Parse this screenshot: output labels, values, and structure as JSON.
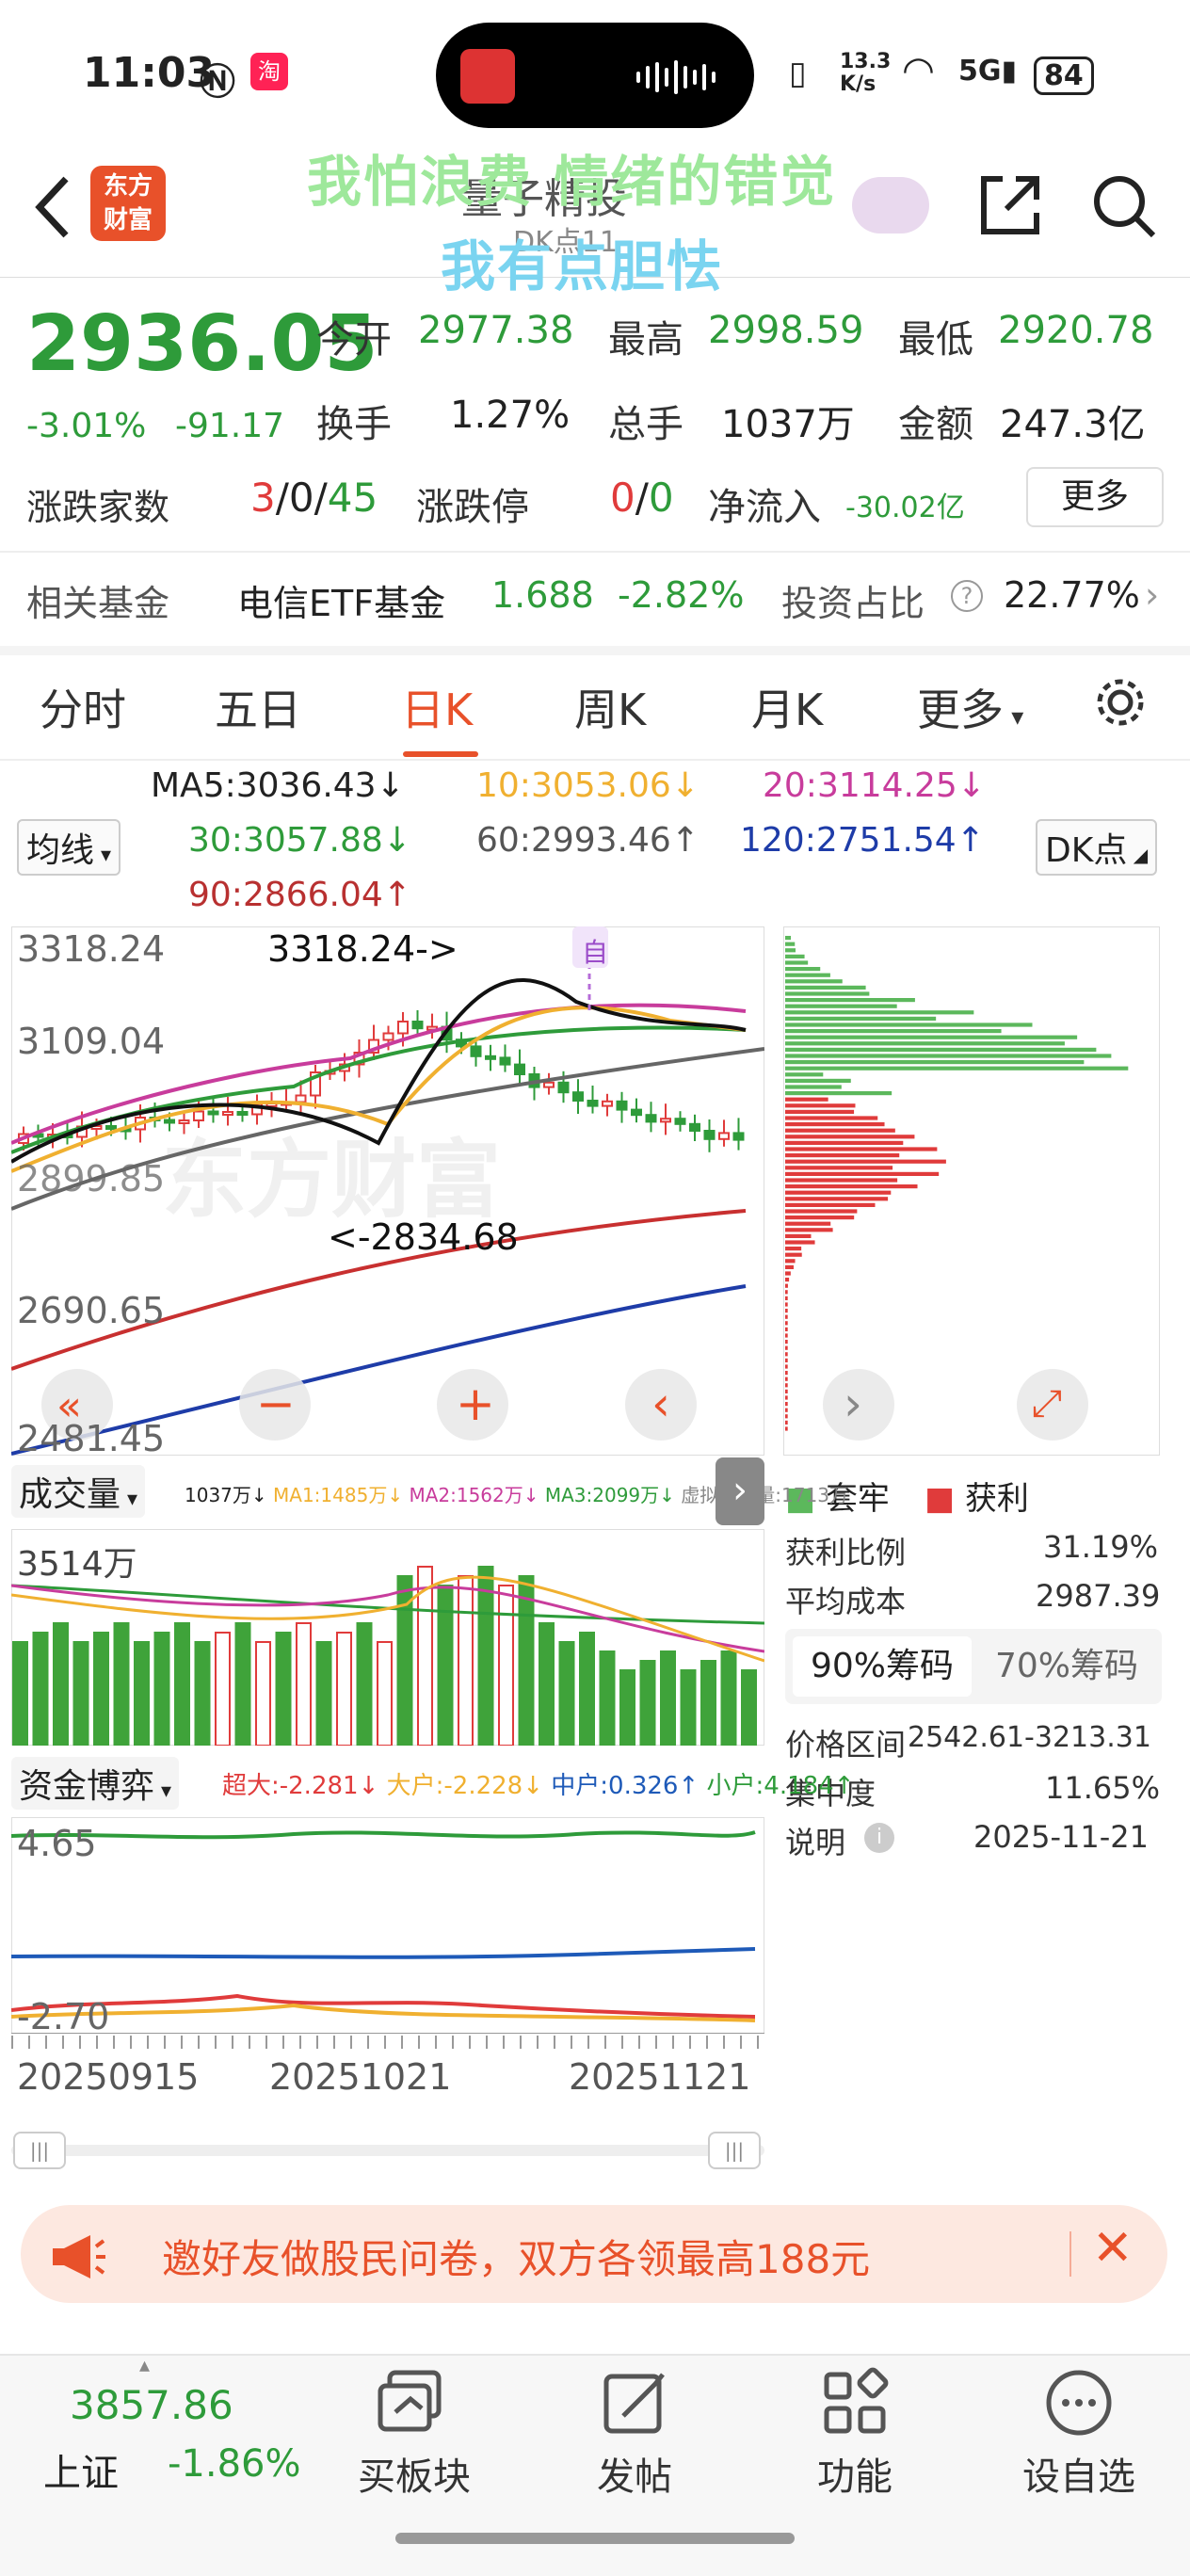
{
  "status": {
    "time": "11:03",
    "net_speed": "13.3\nK/s",
    "battery": "84",
    "signal": "5G"
  },
  "overlay": {
    "line1": "我怕浪费 情绪的错觉",
    "line2": "我有点胆怯"
  },
  "header": {
    "title": "量子精投",
    "subtitle": "DK点11",
    "logo_text": "东方\n财富"
  },
  "quote": {
    "price": "2936.05",
    "pct": "-3.01%",
    "change": "-91.17",
    "open_label": "今开",
    "open": "2977.38",
    "high_label": "最高",
    "high": "2998.59",
    "low_label": "最低",
    "low": "2920.78",
    "turnover_label": "换手",
    "turnover": "1.27%",
    "volume_label": "总手",
    "volume": "1037万",
    "amount_label": "金额",
    "amount": "247.3亿",
    "updown_label": "涨跌家数",
    "up": "3",
    "flat": "0",
    "down": "45",
    "limit_label": "涨跌停",
    "limit_up": "0",
    "limit_down": "0",
    "inflow_label": "净流入",
    "inflow": "-30.02亿",
    "more_button": "更多"
  },
  "fund": {
    "label": "相关基金",
    "name": "电信ETF基金",
    "price": "1.688",
    "pct": "-2.82%",
    "ratio_label": "投资占比",
    "ratio": "22.77%"
  },
  "tabs": [
    "分时",
    "五日",
    "日K",
    "周K",
    "月K",
    "更多"
  ],
  "ma": {
    "selector": "均线",
    "ma5": "MA5:3036.43↓",
    "ma10": "10:3053.06↓",
    "ma20": "20:3114.25↓",
    "ma30": "30:3057.88↓",
    "ma60": "60:2993.46↑",
    "ma120": "120:2751.54↑",
    "ma90": "90:2866.04↑",
    "dk": "DK点"
  },
  "kchart": {
    "y_labels": [
      "3318.24",
      "3109.04",
      "2899.85",
      "2690.65",
      "2481.45"
    ],
    "high_note": "3318.24->",
    "low_note": "<-2834.68",
    "self_tag": "自"
  },
  "volume": {
    "selector": "成交量",
    "axis": "3514万",
    "items": [
      "1037万↓",
      "MA1:1485万↓",
      "MA2:1562万↓",
      "MA3:2099万↓",
      "虚拟成交量:1713万"
    ]
  },
  "capital": {
    "selector": "资金博弈",
    "items": [
      "超大:-2.281↓",
      "大户:-2.228↓",
      "中户:0.326↑",
      "小户:4.184↑"
    ],
    "y_top": "4.65",
    "y_bottom": "-2.70"
  },
  "dates": [
    "20250915",
    "20251021",
    "20251121"
  ],
  "chips": {
    "legend_trapped": "套牢",
    "legend_profit": "获利",
    "rows": [
      {
        "label": "获利比例",
        "value": "31.19%"
      },
      {
        "label": "平均成本",
        "value": "2987.39"
      }
    ],
    "tab90": "90%筹码",
    "tab70": "70%筹码",
    "rows2": [
      {
        "label": "价格区间",
        "value": "2542.61-3213.31"
      },
      {
        "label": "集中度",
        "value": "11.65%"
      },
      {
        "label": "说明",
        "value": "2025-11-21"
      }
    ]
  },
  "banner": {
    "text": "邀好友做股民问卷，双方各领最高188元"
  },
  "bottom": {
    "index_value": "3857.86",
    "index_name": "上证",
    "index_pct": "-1.86%",
    "items": [
      "买板块",
      "发帖",
      "功能",
      "设自选"
    ]
  },
  "colors": {
    "up": "#e03b3b",
    "down": "#2e9b3a",
    "accent": "#e8512a"
  }
}
